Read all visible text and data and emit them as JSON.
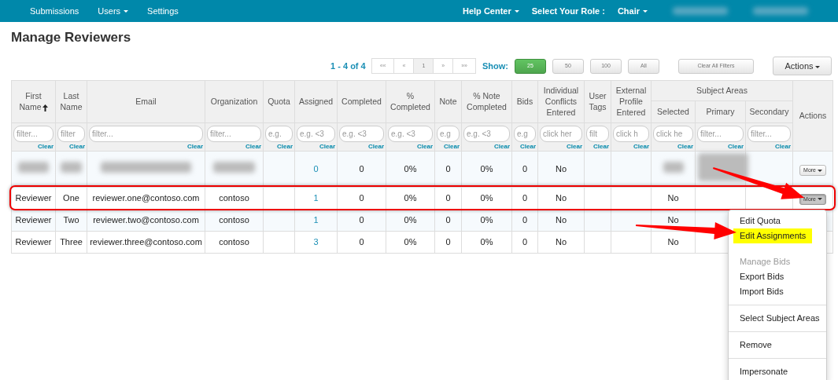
{
  "navbar": {
    "left": [
      {
        "label": "Submissions",
        "dropdown": false
      },
      {
        "label": "Users",
        "dropdown": true
      },
      {
        "label": "Settings",
        "dropdown": false
      }
    ],
    "right": [
      {
        "kind": "menu",
        "label": "Help Center",
        "dropdown": true
      },
      {
        "kind": "text",
        "label": "Select Your Role :"
      },
      {
        "kind": "menu",
        "label": "Chair",
        "dropdown": true
      },
      {
        "kind": "blurred"
      },
      {
        "kind": "blurred"
      }
    ]
  },
  "page_title": "Manage Reviewers",
  "pager": {
    "summary": "1 - 4 of 4",
    "buttons": [
      {
        "label": "««",
        "selected": false
      },
      {
        "label": "«",
        "selected": false
      },
      {
        "label": "1",
        "selected": true
      },
      {
        "label": "»",
        "selected": false
      },
      {
        "label": "»»",
        "selected": false
      }
    ]
  },
  "show": {
    "label": "Show:",
    "options": [
      {
        "label": "25",
        "selected": true
      },
      {
        "label": "50",
        "selected": false
      },
      {
        "label": "100",
        "selected": false
      },
      {
        "label": "All",
        "selected": false
      }
    ]
  },
  "clear_filters": "Clear All Filters",
  "actions_button": "Actions",
  "table": {
    "columns": [
      {
        "label": "First Name",
        "sorted": true,
        "filter": {
          "placeholder": "filter...",
          "clear": "Clear"
        }
      },
      {
        "label": "Last Name",
        "sorted": false,
        "filter": {
          "placeholder": "filter",
          "clear": "Clear"
        }
      },
      {
        "label": "Email",
        "sorted": false,
        "filter": {
          "placeholder": "filter...",
          "clear": "Clear"
        }
      },
      {
        "label": "Organization",
        "sorted": false,
        "filter": {
          "placeholder": "filter...",
          "clear": "Clear"
        }
      },
      {
        "label": "Quota",
        "sorted": false,
        "filter": {
          "placeholder": "e.g.",
          "clear": "Clear"
        }
      },
      {
        "label": "Assigned",
        "sorted": false,
        "filter": {
          "placeholder": "e.g. <3",
          "clear": "Clear"
        }
      },
      {
        "label": "Completed",
        "sorted": false,
        "filter": {
          "placeholder": "e.g. <3",
          "clear": "Clear"
        }
      },
      {
        "label": "% Completed",
        "sorted": false,
        "filter": {
          "placeholder": "e.g. <3",
          "clear": "Clear"
        }
      },
      {
        "label": "Note",
        "sorted": false,
        "filter": {
          "placeholder": "e.g",
          "clear": "Clear"
        }
      },
      {
        "label": "% Note Completed",
        "sorted": false,
        "filter": {
          "placeholder": "e.g. <3",
          "clear": "Clear"
        }
      },
      {
        "label": "Bids",
        "sorted": false,
        "filter": {
          "placeholder": "e.g",
          "clear": "Clear"
        }
      },
      {
        "label": "Individual Conflicts Entered",
        "sorted": false,
        "filter": {
          "placeholder": "click her",
          "clear": "Clear"
        }
      },
      {
        "label": "User Tags",
        "sorted": false,
        "filter": {
          "placeholder": "filt",
          "clear": "Clear"
        }
      },
      {
        "label": "External Profile Entered",
        "sorted": false,
        "filter": {
          "placeholder": "click h",
          "clear": "Clear"
        }
      },
      {
        "label": "Subject Areas",
        "children": [
          {
            "label": "Selected",
            "sorted": false,
            "filter": {
              "placeholder": "click he",
              "clear": "Clear"
            }
          },
          {
            "label": "Primary",
            "sorted": false,
            "filter": {
              "placeholder": "filter...",
              "clear": "Clear"
            }
          },
          {
            "label": "Secondary",
            "sorted": false,
            "filter": {
              "placeholder": "filter...",
              "clear": "Clear"
            }
          }
        ]
      },
      {
        "label": "Actions",
        "sorted": false
      }
    ],
    "rows": [
      {
        "outlined": false,
        "menu_open": false,
        "action": "More",
        "cells": [
          {
            "kind": "blurred"
          },
          {
            "kind": "blurred"
          },
          {
            "kind": "blurred"
          },
          {
            "kind": "blurred"
          },
          {
            "kind": "empty"
          },
          {
            "kind": "link",
            "text": "0"
          },
          {
            "kind": "text",
            "text": "0"
          },
          {
            "kind": "text",
            "text": "0%"
          },
          {
            "kind": "text",
            "text": "0"
          },
          {
            "kind": "text",
            "text": "0%"
          },
          {
            "kind": "text",
            "text": "0"
          },
          {
            "kind": "text",
            "text": "No"
          },
          {
            "kind": "empty"
          },
          {
            "kind": "empty"
          },
          {
            "kind": "blurred"
          },
          {
            "kind": "blurred"
          },
          {
            "kind": "empty"
          }
        ]
      },
      {
        "outlined": true,
        "menu_open": true,
        "action": "More",
        "cells": [
          {
            "kind": "text",
            "text": "Reviewer"
          },
          {
            "kind": "text",
            "text": "One"
          },
          {
            "kind": "text",
            "text": "reviewer.one@contoso.com"
          },
          {
            "kind": "text",
            "text": "contoso"
          },
          {
            "kind": "empty"
          },
          {
            "kind": "link",
            "text": "1"
          },
          {
            "kind": "text",
            "text": "0"
          },
          {
            "kind": "text",
            "text": "0%"
          },
          {
            "kind": "text",
            "text": "0"
          },
          {
            "kind": "text",
            "text": "0%"
          },
          {
            "kind": "text",
            "text": "0"
          },
          {
            "kind": "text",
            "text": "No"
          },
          {
            "kind": "empty"
          },
          {
            "kind": "empty"
          },
          {
            "kind": "text",
            "text": "No"
          },
          {
            "kind": "empty"
          },
          {
            "kind": "empty"
          }
        ]
      },
      {
        "outlined": false,
        "menu_open": false,
        "cells": [
          {
            "kind": "text",
            "text": "Reviewer"
          },
          {
            "kind": "text",
            "text": "Two"
          },
          {
            "kind": "text",
            "text": "reviewer.two@contoso.com"
          },
          {
            "kind": "text",
            "text": "contoso"
          },
          {
            "kind": "empty"
          },
          {
            "kind": "link",
            "text": "1"
          },
          {
            "kind": "text",
            "text": "0"
          },
          {
            "kind": "text",
            "text": "0%"
          },
          {
            "kind": "text",
            "text": "0"
          },
          {
            "kind": "text",
            "text": "0%"
          },
          {
            "kind": "text",
            "text": "0"
          },
          {
            "kind": "text",
            "text": "No"
          },
          {
            "kind": "empty"
          },
          {
            "kind": "empty"
          },
          {
            "kind": "text",
            "text": "No"
          },
          {
            "kind": "empty"
          },
          {
            "kind": "empty"
          }
        ]
      },
      {
        "outlined": false,
        "menu_open": false,
        "cells": [
          {
            "kind": "text",
            "text": "Reviewer"
          },
          {
            "kind": "text",
            "text": "Three"
          },
          {
            "kind": "text",
            "text": "reviewer.three@contoso.com"
          },
          {
            "kind": "text",
            "text": "contoso"
          },
          {
            "kind": "empty"
          },
          {
            "kind": "link",
            "text": "3"
          },
          {
            "kind": "text",
            "text": "0"
          },
          {
            "kind": "text",
            "text": "0%"
          },
          {
            "kind": "text",
            "text": "0"
          },
          {
            "kind": "text",
            "text": "0%"
          },
          {
            "kind": "text",
            "text": "0"
          },
          {
            "kind": "text",
            "text": "No"
          },
          {
            "kind": "empty"
          },
          {
            "kind": "empty"
          },
          {
            "kind": "text",
            "text": "No"
          },
          {
            "kind": "empty"
          },
          {
            "kind": "empty"
          }
        ]
      }
    ]
  },
  "row_menu": {
    "items": [
      {
        "kind": "item",
        "label": "Edit Quota",
        "highlighted": false
      },
      {
        "kind": "item",
        "label": "Edit Assignments",
        "highlighted": true
      },
      {
        "kind": "header",
        "label": "Manage Bids"
      },
      {
        "kind": "item",
        "label": "Export Bids",
        "highlighted": false
      },
      {
        "kind": "item",
        "label": "Import Bids",
        "highlighted": false
      },
      {
        "kind": "divider"
      },
      {
        "kind": "item",
        "label": "Select Subject Areas",
        "highlighted": false
      },
      {
        "kind": "divider"
      },
      {
        "kind": "item",
        "label": "Remove",
        "highlighted": false
      },
      {
        "kind": "divider"
      },
      {
        "kind": "item",
        "label": "Impersonate",
        "highlighted": false
      }
    ]
  }
}
